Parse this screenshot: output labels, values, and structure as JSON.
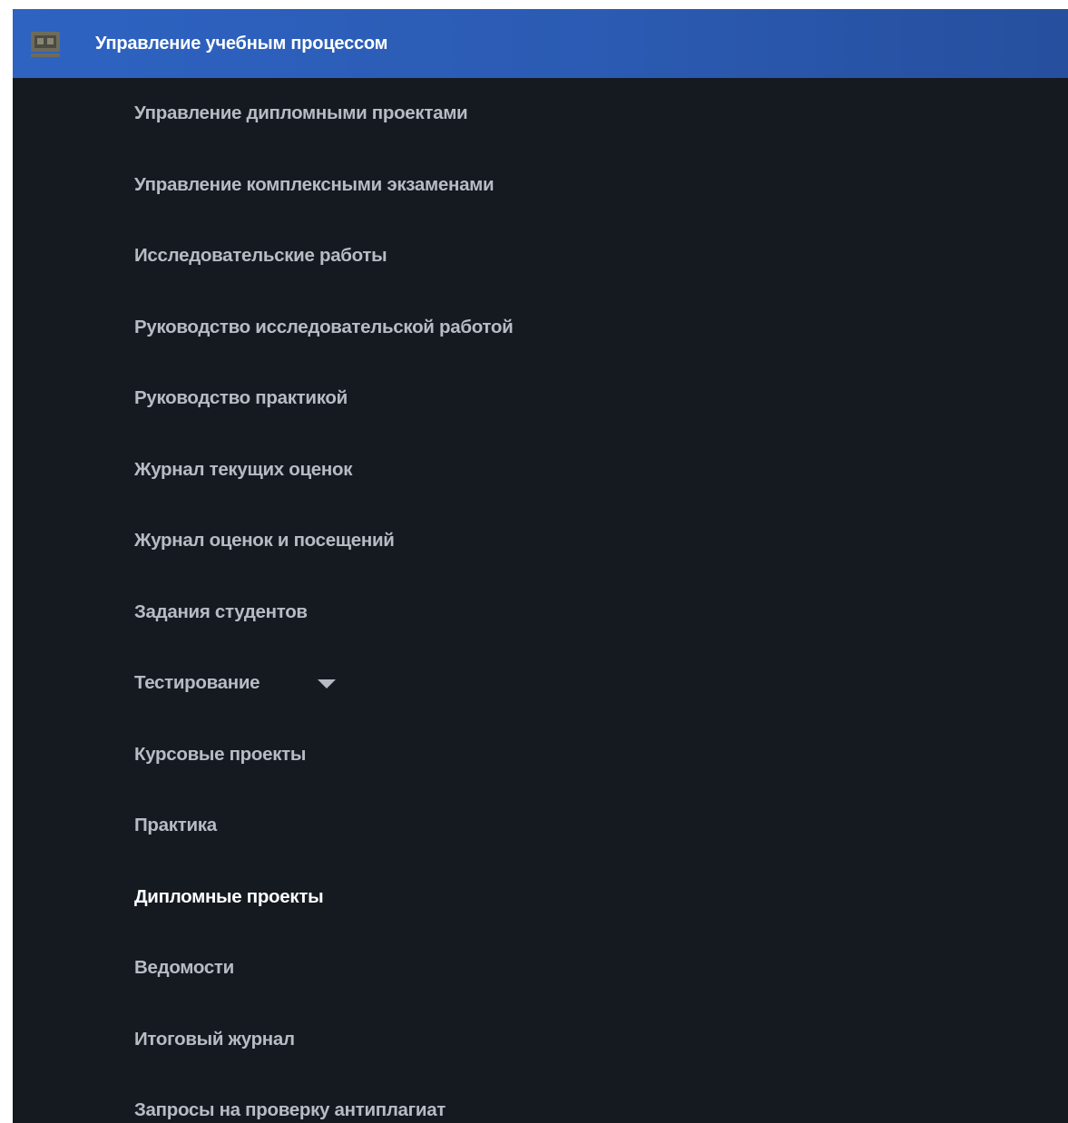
{
  "header": {
    "icon": "monitor-icon",
    "title": "Управление учебным процессом"
  },
  "colors": {
    "header_bg": "#2b5bb3",
    "panel_bg": "#151a21",
    "item_text": "#b7bcc4",
    "active_text": "#ffffff"
  },
  "menu": {
    "items": [
      {
        "label": "Управление дипломными проектами"
      },
      {
        "label": "Управление комплексными экзаменами"
      },
      {
        "label": "Исследовательские работы"
      },
      {
        "label": "Руководство исследовательской работой"
      },
      {
        "label": "Руководство практикой"
      },
      {
        "label": "Журнал текущих оценок"
      },
      {
        "label": "Журнал оценок и посещений"
      },
      {
        "label": "Задания студентов"
      },
      {
        "label": "Тестирование",
        "icon": "chevron-down-icon"
      },
      {
        "label": "Курсовые проекты"
      },
      {
        "label": "Практика"
      },
      {
        "label": "Дипломные проекты",
        "active": true
      },
      {
        "label": "Ведомости"
      },
      {
        "label": "Итоговый журнал"
      },
      {
        "label": "Запросы на проверку антиплагиат"
      }
    ]
  }
}
